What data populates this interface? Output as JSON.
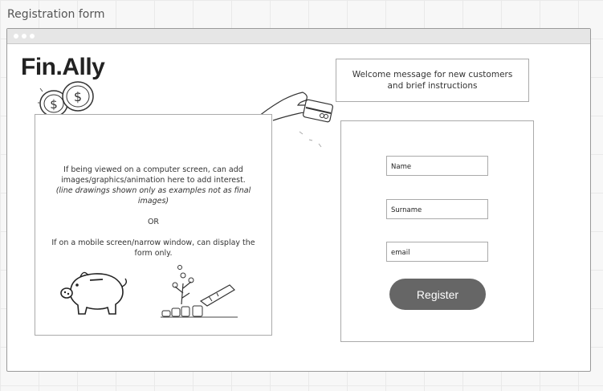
{
  "frame": {
    "title": "Registration form"
  },
  "app": {
    "logo": "Fin.Ally"
  },
  "welcome": {
    "text": "Welcome message for new customers and brief instructions"
  },
  "info": {
    "line1": "If being viewed on a computer screen, can add images/graphics/animation here to add interest.",
    "note": "(line drawings shown only as examples not as final images)",
    "or": "OR",
    "line2": "If on a mobile screen/narrow window, can display the form only."
  },
  "form": {
    "name_label": "Name",
    "surname_label": "Surname",
    "email_label": "email",
    "register_label": "Register"
  },
  "colors": {
    "button": "#666666",
    "border": "#aaaaaa"
  }
}
